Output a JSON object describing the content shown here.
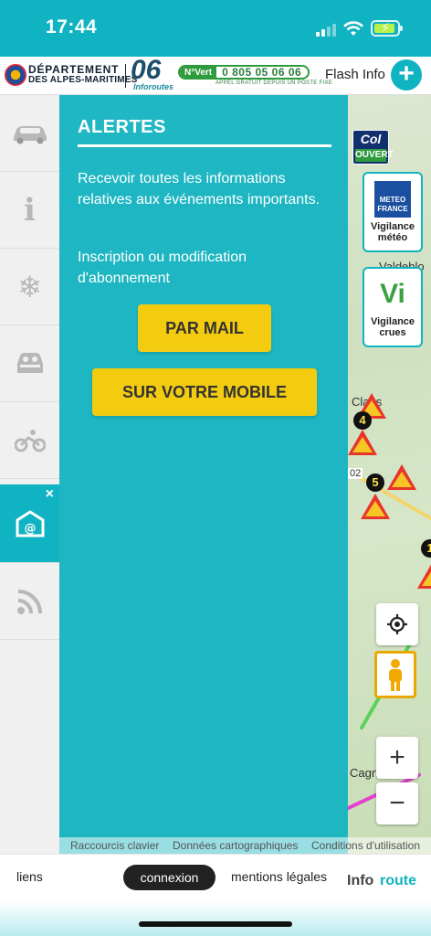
{
  "status_bar": {
    "time": "17:44"
  },
  "header": {
    "dept_line1": "DÉPARTEMENT",
    "dept_line2": "DES ALPES-MARITIMES",
    "logo06": "06",
    "logo06_sub": "Inforoutes",
    "novert_badge": "N°Vert",
    "novert_number": "0 805 05 06 06",
    "novert_sub": "APPEL GRATUIT DEPUIS UN POSTE FIXE",
    "flash_info": "Flash Info",
    "plus": "+"
  },
  "sidebar": {
    "items": [
      {
        "name": "car",
        "icon": "car-icon"
      },
      {
        "name": "info",
        "icon": "info-icon",
        "glyph": "i"
      },
      {
        "name": "snow",
        "icon": "snowflake-icon",
        "glyph": "❄"
      },
      {
        "name": "carpool",
        "icon": "carpool-icon"
      },
      {
        "name": "bike",
        "icon": "bike-icon"
      },
      {
        "name": "alerts",
        "icon": "email-alert-icon",
        "active": true,
        "close": "×"
      },
      {
        "name": "rss",
        "icon": "rss-icon"
      }
    ]
  },
  "panel": {
    "title": "ALERTES",
    "text1": "Recevoir toutes les informations relatives aux événements importants.",
    "text2": "Inscription ou modification d'abonnement",
    "btn_mail": "PAR MAIL",
    "btn_mobile": "SUR VOTRE MOBILE"
  },
  "widgets": {
    "col_top": "Col",
    "col_bottom": "OUVERT",
    "meteo_logo": "METEO FRANCE",
    "meteo_label_1": "Vigilance",
    "meteo_label_2": "météo",
    "crues_logo": "Vi",
    "crues_label_1": "Vigilance",
    "crues_label_2": "crues",
    "zoom_in": "+",
    "zoom_out": "−"
  },
  "map": {
    "towns": [
      "Clans",
      "Valdeblo",
      "Cagnes-s"
    ],
    "route_label": "02",
    "markers": [
      "4",
      "5",
      "1"
    ]
  },
  "attribution": {
    "a": "Raccourcis clavier",
    "b": "Données cartographiques",
    "c": "Conditions d'utilisation"
  },
  "footer": {
    "liens": "liens",
    "connexion": "connexion",
    "mentions": "mentions légales",
    "inforoute_1": "Info",
    "inforoute_2": "route"
  },
  "colors": {
    "accent": "#10b3c2",
    "button": "#f4cc0f",
    "green": "#2e9b3e"
  }
}
